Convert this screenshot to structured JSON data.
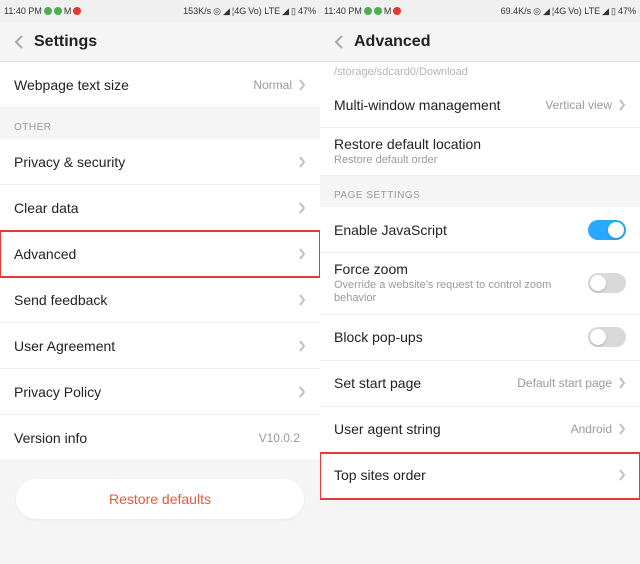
{
  "left": {
    "status": {
      "time": "11:40 PM",
      "speed": "153K/s",
      "net": "4G",
      "lte": "Vo) LTE",
      "battery": "47%"
    },
    "title": "Settings",
    "rows": {
      "text_size": {
        "label": "Webpage text size",
        "value": "Normal"
      },
      "other_header": "OTHER",
      "privacy": "Privacy & security",
      "clear": "Clear data",
      "advanced": "Advanced",
      "feedback": "Send feedback",
      "agreement": "User Agreement",
      "privacy_policy": "Privacy Policy",
      "version": {
        "label": "Version info",
        "value": "V10.0.2"
      }
    },
    "restore": "Restore defaults"
  },
  "right": {
    "status": {
      "time": "11:40 PM",
      "speed": "69.4K/s",
      "net": "4G",
      "lte": "Vo) LTE",
      "battery": "47%"
    },
    "title": "Advanced",
    "path": "/storage/sdcard0/Download",
    "rows": {
      "multiwindow": {
        "label": "Multi-window management",
        "value": "Vertical view"
      },
      "restore_loc": {
        "label": "Restore default location",
        "sub": "Restore default order"
      },
      "page_header": "PAGE SETTINGS",
      "js": {
        "label": "Enable JavaScript",
        "on": true
      },
      "zoom": {
        "label": "Force zoom",
        "sub": "Override a website's request to control zoom behavior",
        "on": false
      },
      "popups": {
        "label": "Block pop-ups",
        "on": false
      },
      "startpage": {
        "label": "Set start page",
        "value": "Default start page"
      },
      "ua": {
        "label": "User agent string",
        "value": "Android"
      },
      "topsites": "Top sites order"
    }
  }
}
